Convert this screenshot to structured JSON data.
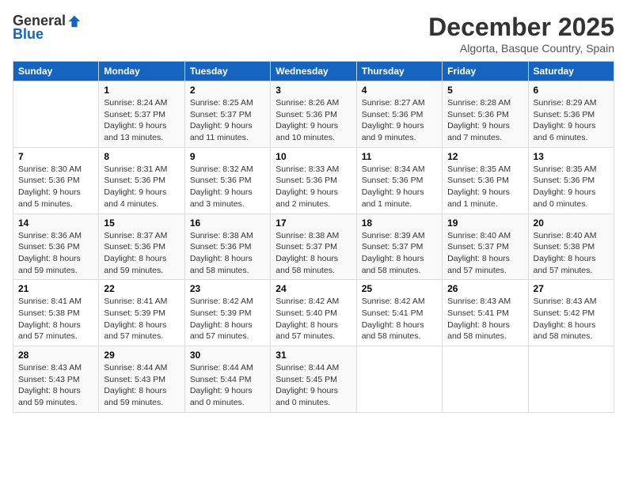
{
  "header": {
    "logo_general": "General",
    "logo_blue": "Blue",
    "title": "December 2025",
    "location": "Algorta, Basque Country, Spain"
  },
  "weekdays": [
    "Sunday",
    "Monday",
    "Tuesday",
    "Wednesday",
    "Thursday",
    "Friday",
    "Saturday"
  ],
  "weeks": [
    [
      {
        "day": "",
        "info": ""
      },
      {
        "day": "1",
        "info": "Sunrise: 8:24 AM\nSunset: 5:37 PM\nDaylight: 9 hours\nand 13 minutes."
      },
      {
        "day": "2",
        "info": "Sunrise: 8:25 AM\nSunset: 5:37 PM\nDaylight: 9 hours\nand 11 minutes."
      },
      {
        "day": "3",
        "info": "Sunrise: 8:26 AM\nSunset: 5:36 PM\nDaylight: 9 hours\nand 10 minutes."
      },
      {
        "day": "4",
        "info": "Sunrise: 8:27 AM\nSunset: 5:36 PM\nDaylight: 9 hours\nand 9 minutes."
      },
      {
        "day": "5",
        "info": "Sunrise: 8:28 AM\nSunset: 5:36 PM\nDaylight: 9 hours\nand 7 minutes."
      },
      {
        "day": "6",
        "info": "Sunrise: 8:29 AM\nSunset: 5:36 PM\nDaylight: 9 hours\nand 6 minutes."
      }
    ],
    [
      {
        "day": "7",
        "info": "Sunrise: 8:30 AM\nSunset: 5:36 PM\nDaylight: 9 hours\nand 5 minutes."
      },
      {
        "day": "8",
        "info": "Sunrise: 8:31 AM\nSunset: 5:36 PM\nDaylight: 9 hours\nand 4 minutes."
      },
      {
        "day": "9",
        "info": "Sunrise: 8:32 AM\nSunset: 5:36 PM\nDaylight: 9 hours\nand 3 minutes."
      },
      {
        "day": "10",
        "info": "Sunrise: 8:33 AM\nSunset: 5:36 PM\nDaylight: 9 hours\nand 2 minutes."
      },
      {
        "day": "11",
        "info": "Sunrise: 8:34 AM\nSunset: 5:36 PM\nDaylight: 9 hours\nand 1 minute."
      },
      {
        "day": "12",
        "info": "Sunrise: 8:35 AM\nSunset: 5:36 PM\nDaylight: 9 hours\nand 1 minute."
      },
      {
        "day": "13",
        "info": "Sunrise: 8:35 AM\nSunset: 5:36 PM\nDaylight: 9 hours\nand 0 minutes."
      }
    ],
    [
      {
        "day": "14",
        "info": "Sunrise: 8:36 AM\nSunset: 5:36 PM\nDaylight: 8 hours\nand 59 minutes."
      },
      {
        "day": "15",
        "info": "Sunrise: 8:37 AM\nSunset: 5:36 PM\nDaylight: 8 hours\nand 59 minutes."
      },
      {
        "day": "16",
        "info": "Sunrise: 8:38 AM\nSunset: 5:36 PM\nDaylight: 8 hours\nand 58 minutes."
      },
      {
        "day": "17",
        "info": "Sunrise: 8:38 AM\nSunset: 5:37 PM\nDaylight: 8 hours\nand 58 minutes."
      },
      {
        "day": "18",
        "info": "Sunrise: 8:39 AM\nSunset: 5:37 PM\nDaylight: 8 hours\nand 58 minutes."
      },
      {
        "day": "19",
        "info": "Sunrise: 8:40 AM\nSunset: 5:37 PM\nDaylight: 8 hours\nand 57 minutes."
      },
      {
        "day": "20",
        "info": "Sunrise: 8:40 AM\nSunset: 5:38 PM\nDaylight: 8 hours\nand 57 minutes."
      }
    ],
    [
      {
        "day": "21",
        "info": "Sunrise: 8:41 AM\nSunset: 5:38 PM\nDaylight: 8 hours\nand 57 minutes."
      },
      {
        "day": "22",
        "info": "Sunrise: 8:41 AM\nSunset: 5:39 PM\nDaylight: 8 hours\nand 57 minutes."
      },
      {
        "day": "23",
        "info": "Sunrise: 8:42 AM\nSunset: 5:39 PM\nDaylight: 8 hours\nand 57 minutes."
      },
      {
        "day": "24",
        "info": "Sunrise: 8:42 AM\nSunset: 5:40 PM\nDaylight: 8 hours\nand 57 minutes."
      },
      {
        "day": "25",
        "info": "Sunrise: 8:42 AM\nSunset: 5:41 PM\nDaylight: 8 hours\nand 58 minutes."
      },
      {
        "day": "26",
        "info": "Sunrise: 8:43 AM\nSunset: 5:41 PM\nDaylight: 8 hours\nand 58 minutes."
      },
      {
        "day": "27",
        "info": "Sunrise: 8:43 AM\nSunset: 5:42 PM\nDaylight: 8 hours\nand 58 minutes."
      }
    ],
    [
      {
        "day": "28",
        "info": "Sunrise: 8:43 AM\nSunset: 5:43 PM\nDaylight: 8 hours\nand 59 minutes."
      },
      {
        "day": "29",
        "info": "Sunrise: 8:44 AM\nSunset: 5:43 PM\nDaylight: 8 hours\nand 59 minutes."
      },
      {
        "day": "30",
        "info": "Sunrise: 8:44 AM\nSunset: 5:44 PM\nDaylight: 9 hours\nand 0 minutes."
      },
      {
        "day": "31",
        "info": "Sunrise: 8:44 AM\nSunset: 5:45 PM\nDaylight: 9 hours\nand 0 minutes."
      },
      {
        "day": "",
        "info": ""
      },
      {
        "day": "",
        "info": ""
      },
      {
        "day": "",
        "info": ""
      }
    ]
  ]
}
